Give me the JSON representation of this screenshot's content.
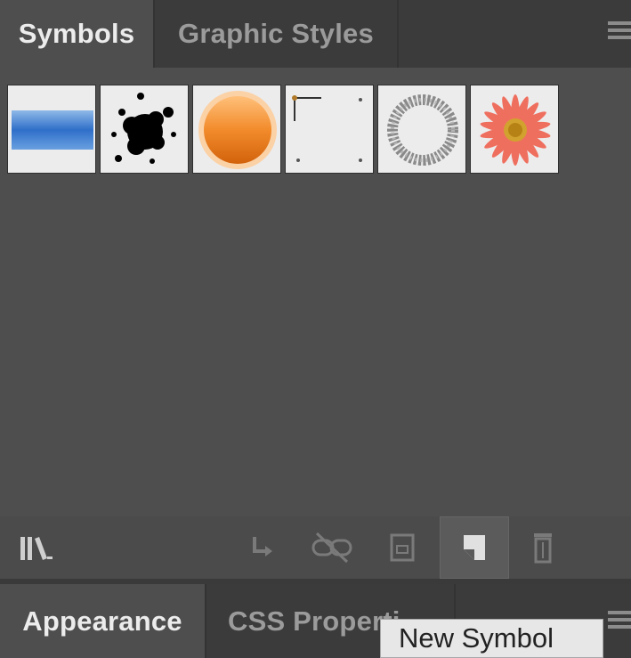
{
  "panel": {
    "tabs": [
      {
        "label": "Symbols",
        "active": true
      },
      {
        "label": "Graphic Styles",
        "active": false
      }
    ],
    "menu_icon": "panel-menu-icon"
  },
  "symbols": {
    "items": [
      {
        "icon": "blue-banner-symbol"
      },
      {
        "icon": "ink-splatter-symbol"
      },
      {
        "icon": "orange-button-symbol"
      },
      {
        "icon": "frame-symbol"
      },
      {
        "icon": "wreath-symbol"
      },
      {
        "icon": "flower-symbol"
      }
    ]
  },
  "toolbar": {
    "buttons": [
      {
        "icon": "symbol-libraries-menu-icon"
      },
      {
        "icon": "place-symbol-instance-icon"
      },
      {
        "icon": "break-link-icon"
      },
      {
        "icon": "symbol-options-icon"
      },
      {
        "icon": "new-symbol-icon",
        "highlighted": true
      },
      {
        "icon": "delete-symbol-icon"
      }
    ]
  },
  "bottom_panel": {
    "tabs": [
      {
        "label": "Appearance",
        "active": true
      },
      {
        "label": "CSS Properti",
        "active": false
      }
    ]
  },
  "tooltip": {
    "text": "New Symbol"
  },
  "colors": {
    "panel_bg": "#4e4e4e",
    "tab_bar_bg": "#3b3b3b",
    "active_tab_text": "#ececec",
    "inactive_tab_text": "#9b9b9b",
    "tooltip_bg": "#e7e7e7"
  }
}
